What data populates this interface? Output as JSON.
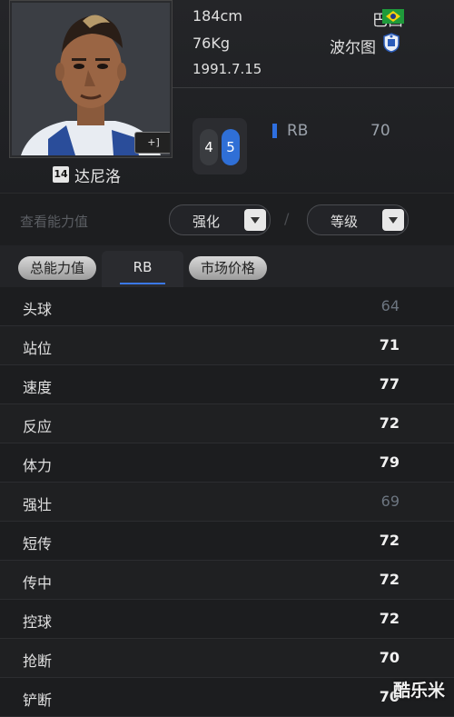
{
  "player": {
    "jersey_number": "14",
    "name": "达尼洛",
    "height": "184cm",
    "weight": "76Kg",
    "dob": "1991.7.15",
    "nationality": "巴西",
    "club": "波尔图",
    "feet": {
      "left": "4",
      "right": "5"
    },
    "position": "RB",
    "position_rating": "70",
    "flip_icon": "card-flip-icon"
  },
  "colors": {
    "accent": "#2e6fe0",
    "dim_value": "#6c7580"
  },
  "filters": {
    "label": "查看能力值",
    "enhance": "强化",
    "separator": "/",
    "level": "等级"
  },
  "tabs": [
    "总能力值",
    "RB",
    "市场价格"
  ],
  "stats": [
    {
      "name": "头球",
      "value": "64",
      "dim": true
    },
    {
      "name": "站位",
      "value": "71",
      "dim": false
    },
    {
      "name": "速度",
      "value": "77",
      "dim": false
    },
    {
      "name": "反应",
      "value": "72",
      "dim": false
    },
    {
      "name": "体力",
      "value": "79",
      "dim": false
    },
    {
      "name": "强壮",
      "value": "69",
      "dim": true
    },
    {
      "name": "短传",
      "value": "72",
      "dim": false
    },
    {
      "name": "传中",
      "value": "72",
      "dim": false
    },
    {
      "name": "控球",
      "value": "72",
      "dim": false
    },
    {
      "name": "抢断",
      "value": "70",
      "dim": false
    },
    {
      "name": "铲断",
      "value": "70",
      "dim": false
    }
  ],
  "watermark": "酷乐米"
}
